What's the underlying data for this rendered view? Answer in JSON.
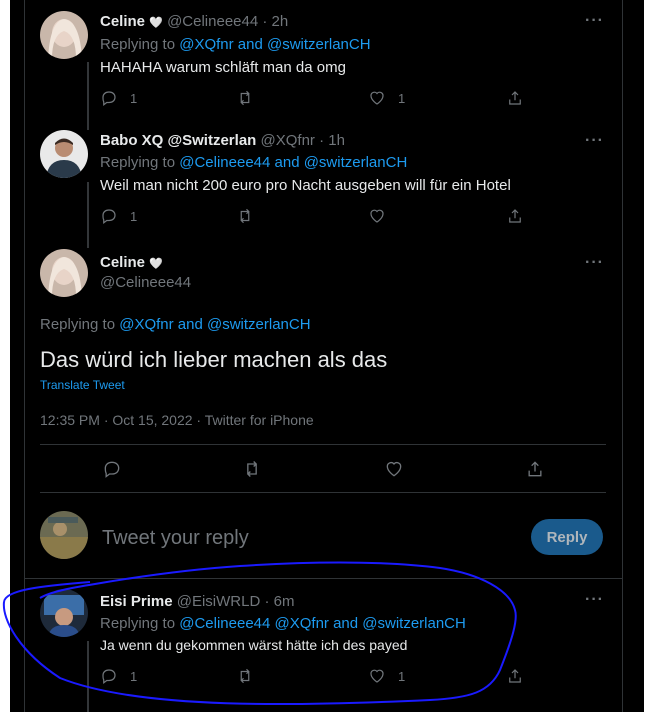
{
  "thread": {
    "tweet1": {
      "name": "Celine",
      "handle_time": "@Celineee44 · 2h",
      "replying_label": "Replying to",
      "mentions": "@XQfnr and @switzerlanCH",
      "text": "HAHAHA warum schläft man da omg",
      "replies": "1",
      "likes": "1"
    },
    "tweet2": {
      "name": "Babo XQ @Switzerlan",
      "handle_time": "@XQfnr · 1h",
      "replying_label": "Replying to",
      "mentions": "@Celineee44 and @switzerlanCH",
      "text": "Weil man nicht 200 euro pro Nacht ausgeben will für ein Hotel",
      "replies": "1"
    },
    "main": {
      "name": "Celine",
      "handle": "@Celineee44",
      "replying_label": "Replying to",
      "mentions": "@XQfnr and @switzerlanCH",
      "text": "Das würd ich lieber machen als das",
      "translate": "Translate Tweet",
      "meta": "12:35 PM · Oct 15, 2022 · Twitter for iPhone"
    }
  },
  "composer": {
    "placeholder": "Tweet your reply",
    "reply_button": "Reply"
  },
  "replies": {
    "tweet4": {
      "name": "Eisi Prime",
      "handle_time": "@EisiWRLD · 6m",
      "replying_label": "Replying to",
      "mentions": "@Celineee44 @XQfnr and @switzerlanCH",
      "text": "Ja wenn du gekommen wärst hätte ich des payed",
      "replies": "1",
      "likes": "1"
    }
  },
  "colors": {
    "background": "#000000",
    "link": "#1d9bf0",
    "muted": "#71767b",
    "annotation": "#1a1aff"
  },
  "icons": [
    "reply-icon",
    "retweet-icon",
    "like-icon",
    "share-icon",
    "more-icon",
    "heart-emoji-icon"
  ]
}
